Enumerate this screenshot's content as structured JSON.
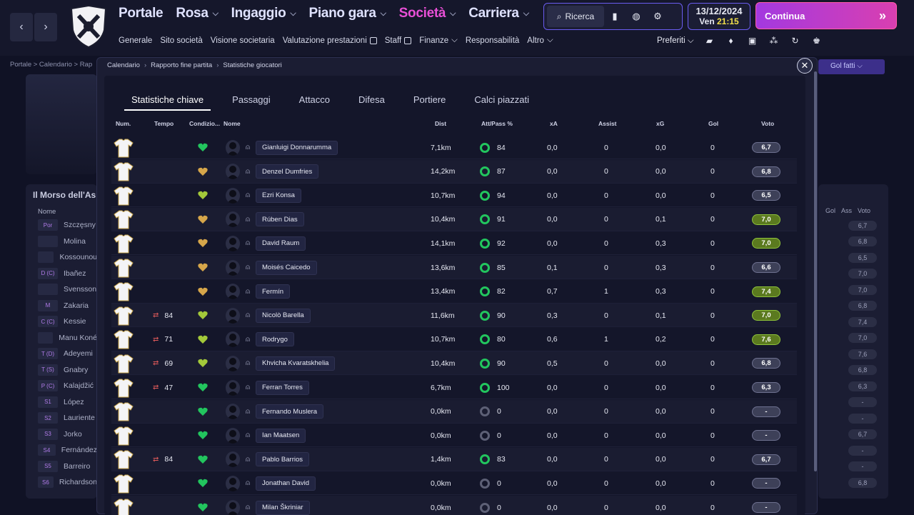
{
  "nav": {
    "main": [
      {
        "label": "Portale"
      },
      {
        "label": "Rosa"
      },
      {
        "label": "Ingaggio"
      },
      {
        "label": "Piano gara"
      },
      {
        "label": "Società"
      },
      {
        "label": "Carriera"
      }
    ],
    "sub": [
      "Generale",
      "Sito società",
      "Visione societaria",
      "Valutazione prestazioni",
      "Staff",
      "Finanze",
      "Responsabilità",
      "Altro"
    ],
    "search_label": "Ricerca",
    "date": "13/12/2024",
    "day": "Ven",
    "time": "21:15",
    "continue_label": "Continua",
    "prefs_label": "Preferiti"
  },
  "background": {
    "breadcrumb": "Portale  >  Calendario  >  Rap",
    "team_title": "Il Morso dell'Asino",
    "name_header": "Nome",
    "goals_for": "Gol fatti",
    "right_headers": [
      "Gol",
      "Ass",
      "Voto"
    ],
    "squad": [
      {
        "pos": "Por",
        "name": "Szczęsny",
        "rating": "6,7"
      },
      {
        "pos": "",
        "name": "Molina",
        "rating": "6,8"
      },
      {
        "pos": "",
        "name": "Kossounou",
        "rating": "6,5"
      },
      {
        "pos": "D (C)",
        "name": "Ibañez",
        "rating": "7,0"
      },
      {
        "pos": "",
        "name": "Svensson",
        "rating": "7,0"
      },
      {
        "pos": "M",
        "name": "Zakaria",
        "rating": "6,8"
      },
      {
        "pos": "C (C)",
        "name": "Kessie",
        "rating": "7,4"
      },
      {
        "pos": "",
        "name": "Manu Koné",
        "rating": "7,0"
      },
      {
        "pos": "T (D)",
        "name": "Adeyemi",
        "rating": "7,6"
      },
      {
        "pos": "T (S)",
        "name": "Gnabry",
        "rating": "6,8"
      },
      {
        "pos": "P (C)",
        "name": "Kalajdžić",
        "rating": "6,3"
      },
      {
        "pos": "S1",
        "name": "López",
        "rating": "-"
      },
      {
        "pos": "S2",
        "name": "Lauriente",
        "rating": "-"
      },
      {
        "pos": "S3",
        "name": "Jorko",
        "rating": "6,7"
      },
      {
        "pos": "S4",
        "name": "Fernández",
        "rating": "-"
      },
      {
        "pos": "S5",
        "name": "Barreiro",
        "rating": "-"
      },
      {
        "pos": "S6",
        "name": "Richardson",
        "rating": "6,8"
      }
    ]
  },
  "modal": {
    "breadcrumb": [
      "Calendario",
      "Rapporto fine partita",
      "Statistiche giocatori"
    ],
    "tabs": [
      "Statistiche chiave",
      "Passaggi",
      "Attacco",
      "Difesa",
      "Portiere",
      "Calci piazzati"
    ],
    "headers": {
      "num": "Num.",
      "time": "Tempo",
      "cond": "Condizio...",
      "name": "Nome",
      "dist": "Dist",
      "pass": "Att/Pass %",
      "xa": "xA",
      "assist": "Assist",
      "xg": "xG",
      "goals": "Gol",
      "rating": "Voto"
    },
    "players": [
      {
        "time": "",
        "sub": "",
        "cond_color": "#22c55e",
        "name": "Gianluigi Donnarumma",
        "dist": "7,1km",
        "pass": "84",
        "pass_active": true,
        "xa": "0,0",
        "assist": "0",
        "xg": "0,0",
        "goals": "0",
        "rating": "6,7",
        "good": false
      },
      {
        "time": "",
        "sub": "",
        "cond_color": "#d6a64a",
        "name": "Denzel Dumfries",
        "dist": "14,2km",
        "pass": "87",
        "pass_active": true,
        "xa": "0,0",
        "assist": "0",
        "xg": "0,0",
        "goals": "0",
        "rating": "6,8",
        "good": false
      },
      {
        "time": "",
        "sub": "",
        "cond_color": "#a3c93a",
        "name": "Ezri Konsa",
        "dist": "10,7km",
        "pass": "94",
        "pass_active": true,
        "xa": "0,0",
        "assist": "0",
        "xg": "0,0",
        "goals": "0",
        "rating": "6,5",
        "good": false
      },
      {
        "time": "",
        "sub": "",
        "cond_color": "#d6a64a",
        "name": "Rúben Dias",
        "dist": "10,4km",
        "pass": "91",
        "pass_active": true,
        "xa": "0,0",
        "assist": "0",
        "xg": "0,1",
        "goals": "0",
        "rating": "7,0",
        "good": true
      },
      {
        "time": "",
        "sub": "",
        "cond_color": "#d6a64a",
        "name": "David Raum",
        "dist": "14,1km",
        "pass": "92",
        "pass_active": true,
        "xa": "0,0",
        "assist": "0",
        "xg": "0,3",
        "goals": "0",
        "rating": "7,0",
        "good": true
      },
      {
        "time": "",
        "sub": "",
        "cond_color": "#d6a64a",
        "name": "Moisés Caicedo",
        "dist": "13,6km",
        "pass": "85",
        "pass_active": true,
        "xa": "0,1",
        "assist": "0",
        "xg": "0,3",
        "goals": "0",
        "rating": "6,6",
        "good": false
      },
      {
        "time": "",
        "sub": "",
        "cond_color": "#d6a64a",
        "name": "Fermín",
        "dist": "13,4km",
        "pass": "82",
        "pass_active": true,
        "xa": "0,7",
        "assist": "1",
        "xg": "0,3",
        "goals": "0",
        "rating": "7,4",
        "good": true
      },
      {
        "time": "84",
        "sub": "⇄",
        "cond_color": "#a3c93a",
        "name": "Nicolò Barella",
        "dist": "11,6km",
        "pass": "90",
        "pass_active": true,
        "xa": "0,3",
        "assist": "0",
        "xg": "0,1",
        "goals": "0",
        "rating": "7,0",
        "good": true
      },
      {
        "time": "71",
        "sub": "⇄",
        "cond_color": "#a3c93a",
        "name": "Rodrygo",
        "dist": "10,7km",
        "pass": "80",
        "pass_active": true,
        "xa": "0,6",
        "assist": "1",
        "xg": "0,2",
        "goals": "0",
        "rating": "7,6",
        "good": true
      },
      {
        "time": "69",
        "sub": "⇄",
        "cond_color": "#a3c93a",
        "name": "Khvicha Kvaratskhelia",
        "dist": "10,4km",
        "pass": "90",
        "pass_active": true,
        "xa": "0,5",
        "assist": "0",
        "xg": "0,0",
        "goals": "0",
        "rating": "6,8",
        "good": false
      },
      {
        "time": "47",
        "sub": "⇄",
        "cond_color": "#22c55e",
        "name": "Ferran Torres",
        "dist": "6,7km",
        "pass": "100",
        "pass_active": true,
        "xa": "0,0",
        "assist": "0",
        "xg": "0,0",
        "goals": "0",
        "rating": "6,3",
        "good": false
      },
      {
        "time": "",
        "sub": "",
        "cond_color": "#22c55e",
        "name": "Fernando Muslera",
        "dist": "0,0km",
        "pass": "0",
        "pass_active": false,
        "xa": "0,0",
        "assist": "0",
        "xg": "0,0",
        "goals": "0",
        "rating": "-",
        "good": false
      },
      {
        "time": "",
        "sub": "",
        "cond_color": "#22c55e",
        "name": "Ian Maatsen",
        "dist": "0,0km",
        "pass": "0",
        "pass_active": false,
        "xa": "0,0",
        "assist": "0",
        "xg": "0,0",
        "goals": "0",
        "rating": "-",
        "good": false
      },
      {
        "time": "84",
        "sub": "⇄",
        "cond_color": "#22c55e",
        "name": "Pablo Barrios",
        "dist": "1,4km",
        "pass": "83",
        "pass_active": true,
        "xa": "0,0",
        "assist": "0",
        "xg": "0,0",
        "goals": "0",
        "rating": "6,7",
        "good": false
      },
      {
        "time": "",
        "sub": "",
        "cond_color": "#22c55e",
        "name": "Jonathan David",
        "dist": "0,0km",
        "pass": "0",
        "pass_active": false,
        "xa": "0,0",
        "assist": "0",
        "xg": "0,0",
        "goals": "0",
        "rating": "-",
        "good": false
      },
      {
        "time": "",
        "sub": "",
        "cond_color": "#22c55e",
        "name": "Milan Škriniar",
        "dist": "0,0km",
        "pass": "0",
        "pass_active": false,
        "xa": "0,0",
        "assist": "0",
        "xg": "0,0",
        "goals": "0",
        "rating": "-",
        "good": false
      }
    ]
  }
}
